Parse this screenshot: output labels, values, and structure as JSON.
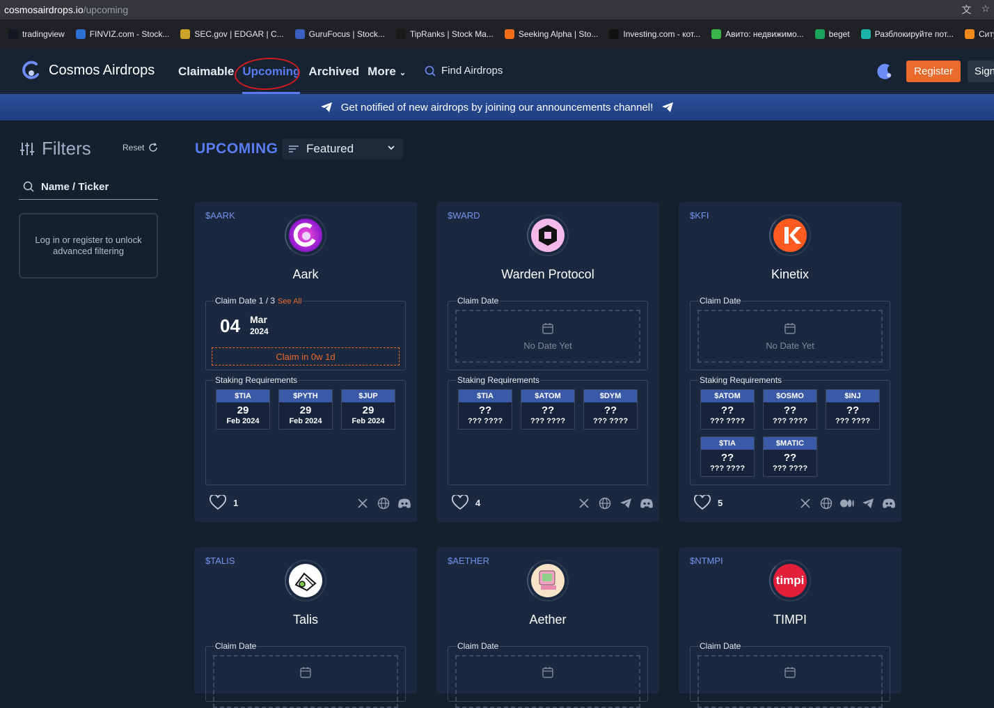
{
  "browser": {
    "url_host": "cosmosairdrops.io",
    "url_path": "/upcoming",
    "bookmarks": [
      {
        "label": "tradingview",
        "color": "#131722"
      },
      {
        "label": "FINVIZ.com - Stock...",
        "color": "#2b6fd0"
      },
      {
        "label": "SEC.gov | EDGAR | C...",
        "color": "#c9a227"
      },
      {
        "label": "GuruFocus | Stock...",
        "color": "#3b5fc0"
      },
      {
        "label": "TipRanks | Stock Ma...",
        "color": "#1a1a1a"
      },
      {
        "label": "Seeking Alpha | Sto...",
        "color": "#f06d1a"
      },
      {
        "label": "Investing.com - кот...",
        "color": "#111111"
      },
      {
        "label": "Авито: недвижимо...",
        "color": "#39b54a"
      },
      {
        "label": "beget",
        "color": "#1aa35a"
      },
      {
        "label": "Разблокируйте пот...",
        "color": "#1bb3a6"
      },
      {
        "label": "Ситу",
        "color": "#f08a1a"
      }
    ]
  },
  "header": {
    "brand": "Cosmos Airdrops",
    "nav": [
      {
        "label": "Claimable",
        "active": false
      },
      {
        "label": "Upcoming",
        "active": true
      },
      {
        "label": "Archived",
        "active": false
      },
      {
        "label": "More",
        "active": false
      }
    ],
    "find_label": "Find Airdrops",
    "register_label": "Register",
    "signin_label": "Sign"
  },
  "banner": {
    "text": "Get notified of new airdrops by joining our announcements channel!"
  },
  "sidebar": {
    "title": "Filters",
    "reset_label": "Reset",
    "search_placeholder": "Name / Ticker",
    "login_note": "Log in or register to unlock advanced filtering"
  },
  "main": {
    "section_title": "UPCOMING",
    "sort_label": "Featured"
  },
  "labels": {
    "claim_date": "Claim Date",
    "staking": "Staking Requirements",
    "no_date": "No Date Yet"
  },
  "cards": [
    {
      "ticker": "$AARK",
      "name": "Aark",
      "claim_header": "Claim Date 1 / 3",
      "see_all": "See All",
      "day": "04",
      "month": "Mar",
      "year": "2024",
      "claim_in": "Claim in 0w 1d",
      "stakes": [
        {
          "tk": "$TIA",
          "d": "29",
          "my": "Feb 2024"
        },
        {
          "tk": "$PYTH",
          "d": "29",
          "my": "Feb 2024"
        },
        {
          "tk": "$JUP",
          "d": "29",
          "my": "Feb 2024"
        }
      ],
      "likes": "1"
    },
    {
      "ticker": "$WARD",
      "name": "Warden Protocol",
      "stakes": [
        {
          "tk": "$TIA",
          "d": "??",
          "my": "??? ????"
        },
        {
          "tk": "$ATOM",
          "d": "??",
          "my": "??? ????"
        },
        {
          "tk": "$DYM",
          "d": "??",
          "my": "??? ????"
        }
      ],
      "likes": "4"
    },
    {
      "ticker": "$KFI",
      "name": "Kinetix",
      "stakes": [
        {
          "tk": "$ATOM",
          "d": "??",
          "my": "??? ????"
        },
        {
          "tk": "$OSMO",
          "d": "??",
          "my": "??? ????"
        },
        {
          "tk": "$INJ",
          "d": "??",
          "my": "??? ????"
        },
        {
          "tk": "$TIA",
          "d": "??",
          "my": "??? ????"
        },
        {
          "tk": "$MATIC",
          "d": "??",
          "my": "??? ????"
        }
      ],
      "likes": "5"
    },
    {
      "ticker": "$TALIS",
      "name": "Talis"
    },
    {
      "ticker": "$AETHER",
      "name": "Aether"
    },
    {
      "ticker": "$NTMPI",
      "name": "TIMPI",
      "logo_text": "timpi"
    }
  ]
}
